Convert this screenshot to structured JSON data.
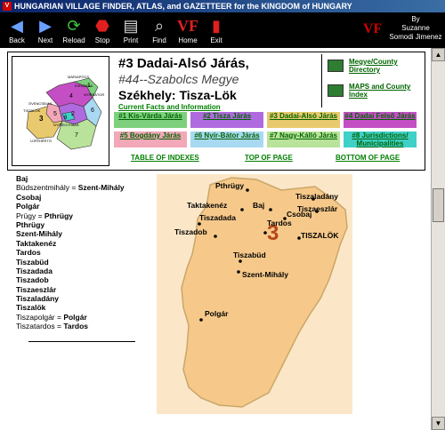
{
  "window": {
    "title": "HUNGARIAN VILLAGE FINDER, ATLAS, and GAZETTEER for the KINGDOM of HUNGARY",
    "icon_letter": "V"
  },
  "toolbar": {
    "buttons": [
      {
        "label": "Back",
        "icon": "back-arrow-icon",
        "glyph": "◀"
      },
      {
        "label": "Next",
        "icon": "forward-arrow-icon",
        "glyph": "▶"
      },
      {
        "label": "Reload",
        "icon": "reload-icon",
        "glyph": "⟳"
      },
      {
        "label": "Stop",
        "icon": "stop-icon",
        "glyph": "⬣"
      },
      {
        "label": "Print",
        "icon": "print-icon",
        "glyph": "▤"
      },
      {
        "label": "Find",
        "icon": "find-icon",
        "glyph": "🔍"
      },
      {
        "label": "Home",
        "icon": "home-logo-icon",
        "glyph": "VF"
      },
      {
        "label": "Exit",
        "icon": "exit-icon",
        "glyph": "▮"
      }
    ],
    "byline": {
      "by": "By",
      "author_first": "Suzanne",
      "author_last": "Somodi Jimenez",
      "logo_text": "VF"
    }
  },
  "header": {
    "title": "#3  Dadai-Alsó Járás,",
    "subtitle": "#44--Szabolcs Megye",
    "seat": "Székhely:  Tisza-Lök",
    "facts_link": "Current Facts and Information",
    "side_links": [
      {
        "label": "Megye/County Directory",
        "icon": "county-map-icon"
      },
      {
        "label": "MAPS and County Index",
        "icon": "maps-icon"
      }
    ],
    "jaras_links": [
      {
        "label": "#1 Kis-Várda Járás",
        "color": "#7ed07e"
      },
      {
        "label": "#2 Tisza Járás",
        "color": "#b06adf"
      },
      {
        "label": "#3 Dadai-Alsó Járás",
        "color": "#e8c96d"
      },
      {
        "label": "#4 Dadai Felső Járás",
        "color": "#c44fc4"
      },
      {
        "label": "#5 Bogdány Járás",
        "color": "#f2a8b8"
      },
      {
        "label": "#6 Nyír-Bátor Járás",
        "color": "#a9d9f2"
      },
      {
        "label": "#7 Nagy-Kálló Járás",
        "color": "#b9e39a"
      },
      {
        "label": "#8 Jurisdictions/ Municipalities",
        "color": "#3fd0c8"
      }
    ],
    "bottom_links": [
      "TABLE OF INDEXES",
      "TOP OF PAGE",
      "BOTTOM OF PAGE"
    ],
    "thumb_labels": [
      "MÁRIAPÓCS",
      "ÖVENCSELLE",
      "NYÍRBÁTOR",
      "TISZALÖK",
      "NYÍREGYHÁZA",
      "UJFEHÉRTÓ",
      "KISVÁRDA"
    ]
  },
  "towns": [
    {
      "std": "Baj"
    },
    {
      "alt": "Büdszentmihály = ",
      "std": "Szent-Mihály"
    },
    {
      "std": "Csobaj"
    },
    {
      "std": "Polgár"
    },
    {
      "alt": "Prügy = ",
      "std": "Pthrügy"
    },
    {
      "std": "Pthrügy"
    },
    {
      "std": "Szent-Mihály"
    },
    {
      "std": "Taktakenéz"
    },
    {
      "std": "Tardos"
    },
    {
      "std": "Tiszabüd"
    },
    {
      "std": "Tiszadada"
    },
    {
      "std": "Tiszadob"
    },
    {
      "std": "Tiszaeszlár"
    },
    {
      "std": "Tiszaladány"
    },
    {
      "std": "Tiszalök"
    },
    {
      "alt": "Tiszapolgár = ",
      "std": "Polgár"
    },
    {
      "alt": "Tiszatardos = ",
      "std": "Tardos"
    }
  ],
  "map": {
    "number": "3",
    "places": [
      "Pthrügy",
      "Tiszaladány",
      "Taktakenéz",
      "Baj",
      "Csobaj",
      "Tiszaeszlár",
      "Tiszadada",
      "Tardos",
      "Tiszadob",
      "TISZALÖK",
      "Tiszabüd",
      "Szent-Mihály",
      "Polgár"
    ]
  }
}
